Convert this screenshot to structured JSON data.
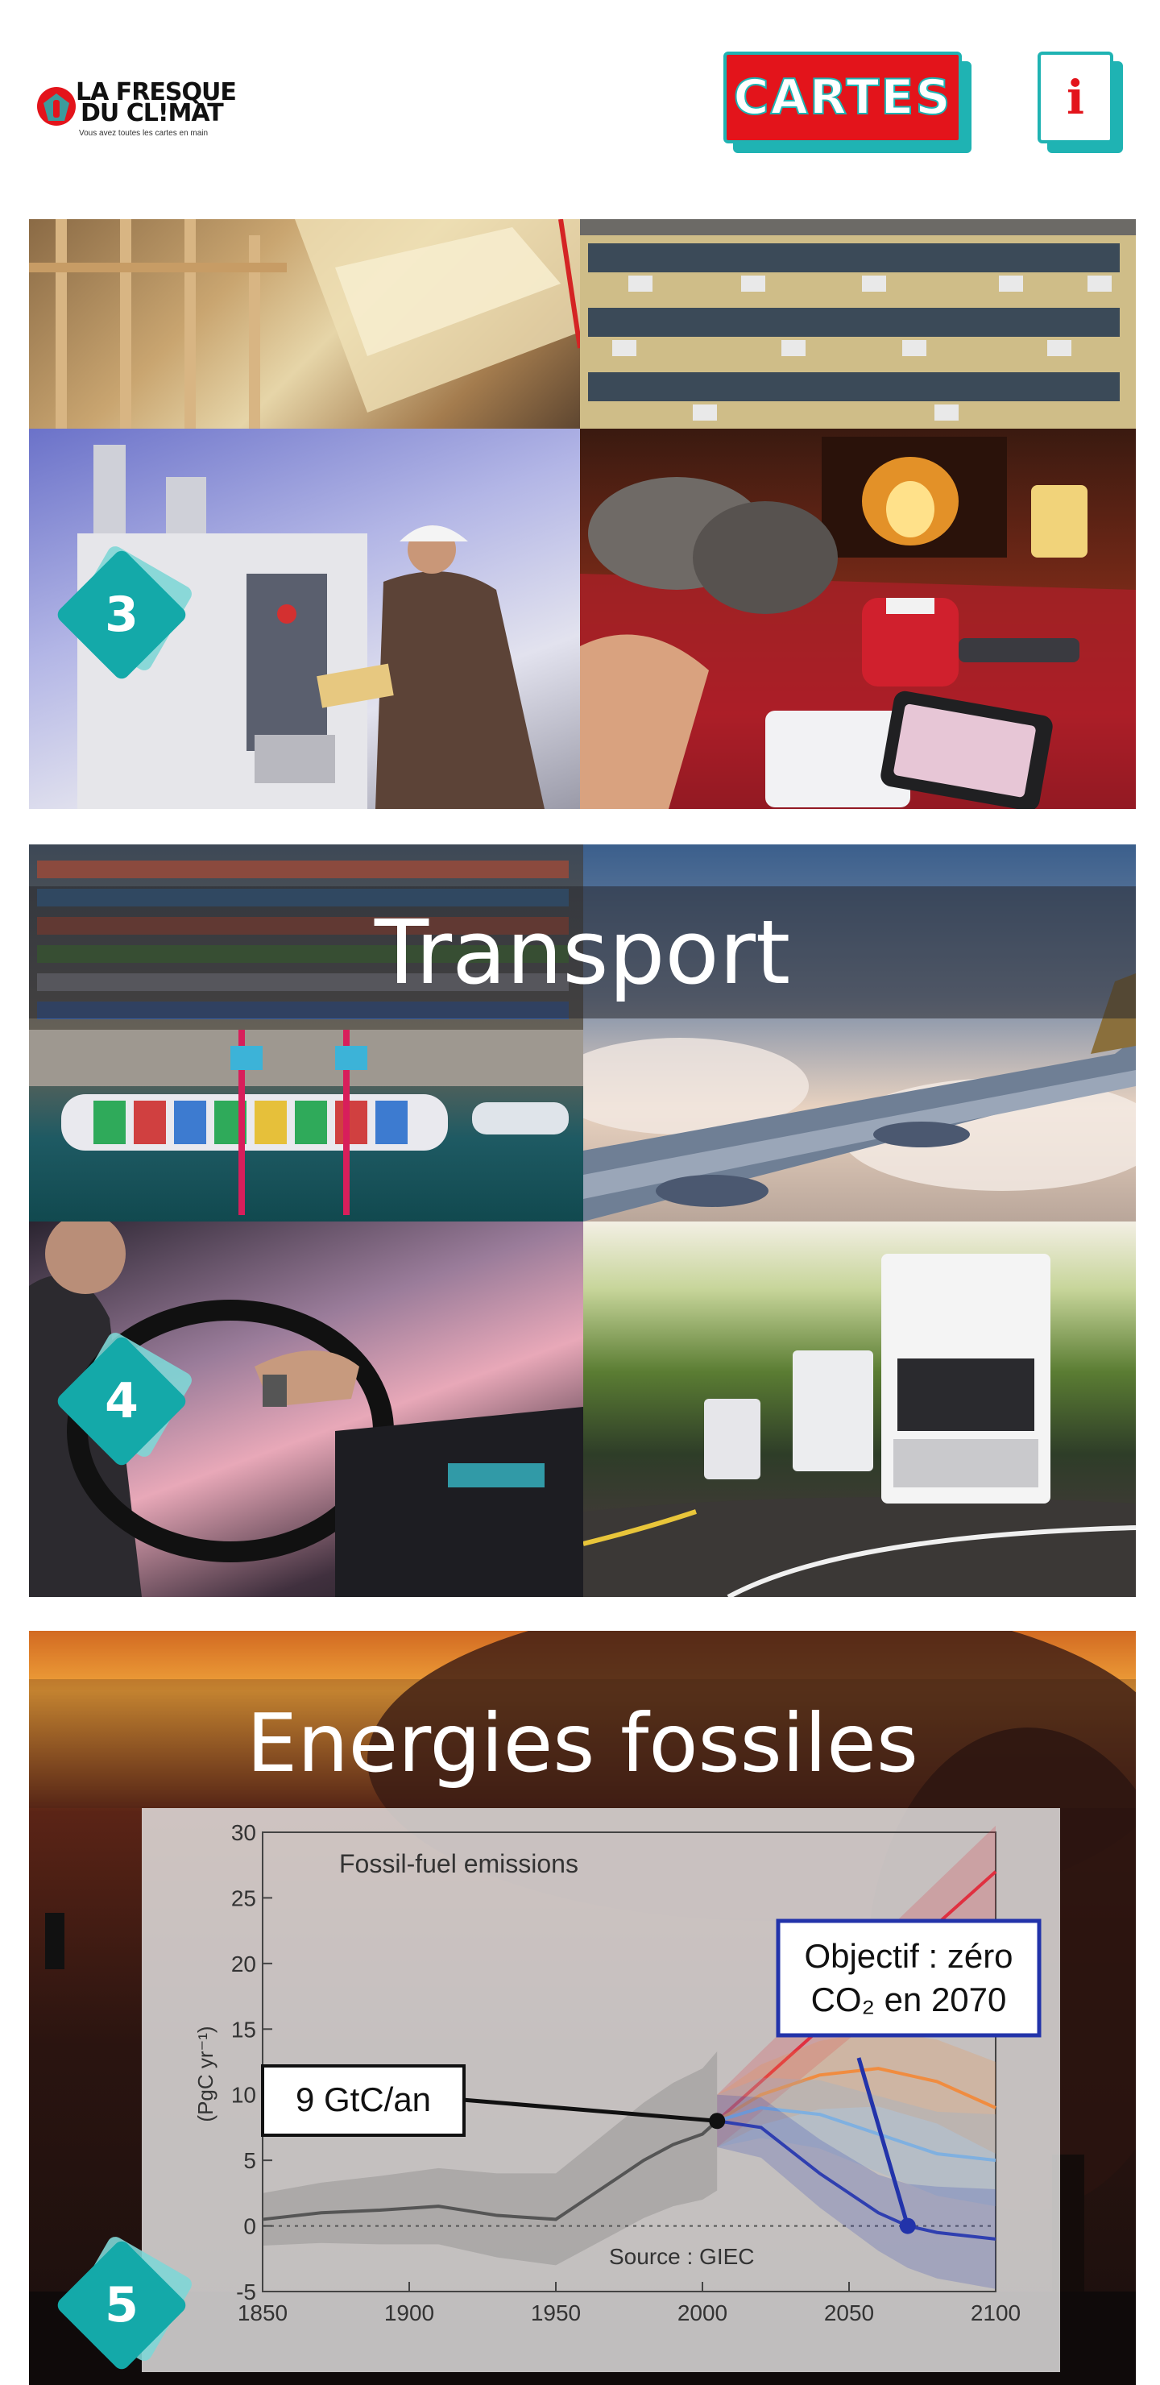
{
  "header": {
    "logo_line1": "LA FRESQUE",
    "logo_line2": "DU CL!MAT",
    "logo_tagline": "Vous avez toutes les cartes en main",
    "cartes_label": "CARTES",
    "info_label": "i"
  },
  "colors": {
    "brand_red": "#e3141b",
    "brand_teal": "#1fb3b3",
    "badge_teal": "#14a9a9"
  },
  "cards": [
    {
      "number": "3",
      "title": ""
    },
    {
      "number": "4",
      "title": "Transport"
    },
    {
      "number": "5",
      "title": "Energies fossiles"
    }
  ],
  "chart_data": {
    "type": "line",
    "title": "Fossil-fuel emissions",
    "xlabel": "",
    "ylabel": "(PgC yr⁻¹)",
    "xlim": [
      1850,
      2100
    ],
    "ylim": [
      -5,
      30
    ],
    "xticks": [
      1850,
      1900,
      1950,
      2000,
      2050,
      2100
    ],
    "yticks": [
      -5,
      0,
      5,
      10,
      15,
      20,
      25,
      30
    ],
    "source": "Source : GIEC",
    "series": [
      {
        "color": "#555555",
        "x": [
          1850,
          1870,
          1890,
          1910,
          1930,
          1950,
          1960,
          1970,
          1980,
          1990,
          2000,
          2005
        ],
        "y": [
          0.5,
          1.0,
          1.2,
          1.5,
          0.8,
          0.5,
          2.0,
          3.5,
          5.0,
          6.2,
          7.0,
          8.0
        ]
      },
      {
        "color": "#e03040",
        "x": [
          2005,
          2020,
          2040,
          2060,
          2080,
          2100
        ],
        "y": [
          8.0,
          11,
          15,
          19,
          23,
          27
        ]
      },
      {
        "color": "#f08c40",
        "x": [
          2005,
          2020,
          2040,
          2060,
          2080,
          2100
        ],
        "y": [
          8.0,
          10,
          11.5,
          12,
          11,
          9
        ]
      },
      {
        "color": "#7fb0e0",
        "x": [
          2005,
          2020,
          2040,
          2060,
          2080,
          2100
        ],
        "y": [
          8.0,
          9,
          8.5,
          7,
          5.5,
          5
        ]
      },
      {
        "color": "#2f3fb0",
        "x": [
          2005,
          2020,
          2040,
          2060,
          2070,
          2080,
          2100
        ],
        "y": [
          8.0,
          7.5,
          4,
          1,
          0,
          -0.5,
          -1
        ]
      }
    ],
    "annotations": [
      {
        "text": "9 GtC/an",
        "x": 2005,
        "y": 8
      },
      {
        "text": "Objectif : zéro CO₂ en 2070",
        "x": 2070,
        "y": 0
      }
    ]
  }
}
